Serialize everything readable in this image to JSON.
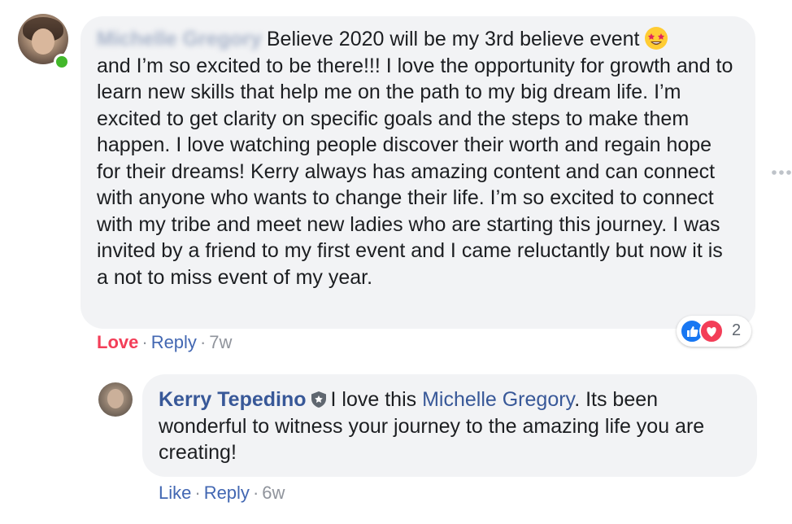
{
  "main_comment": {
    "author_blurred": "Michelle Gregory",
    "text": "Believe 2020 will be my 3rd believe event",
    "text_rest": "and I’m so excited to be there!!! I love the opportunity for growth and to learn new skills that help me on the path to my big dream life. I’m excited to get clarity on specific goals and the steps to make them happen. I love watching people discover their worth and regain hope for their dreams! Kerry always has amazing content and can connect with anyone who wants to change their life. I’m so excited to connect with my tribe and meet new ladies who are starting this journey. I was invited by a friend to my first event and I came reluctantly but now it is a not to miss event of my year.",
    "emoji_icon": "star-struck-emoji-icon",
    "actions": {
      "love": "Love",
      "reply": "Reply",
      "time": "7w",
      "separator": "·"
    },
    "reactions": {
      "icons": [
        "like-icon",
        "heart-icon"
      ],
      "count": "2"
    },
    "author_online": true
  },
  "reply_comment": {
    "author": "Kerry Tepedino",
    "badge_icon": "shield-badge-icon",
    "text_before": "I love this",
    "mention": "Michelle Gregory",
    "text_after": ". Its been wonderful to witness your journey to the amazing life you are creating!",
    "actions": {
      "like": "Like",
      "reply": "Reply",
      "time": "6w",
      "separator": "·"
    }
  },
  "colors": {
    "bubble": "#f2f3f5",
    "link": "#385898",
    "love": "#f33e58",
    "meta": "#90949c",
    "online": "#42b72a"
  }
}
